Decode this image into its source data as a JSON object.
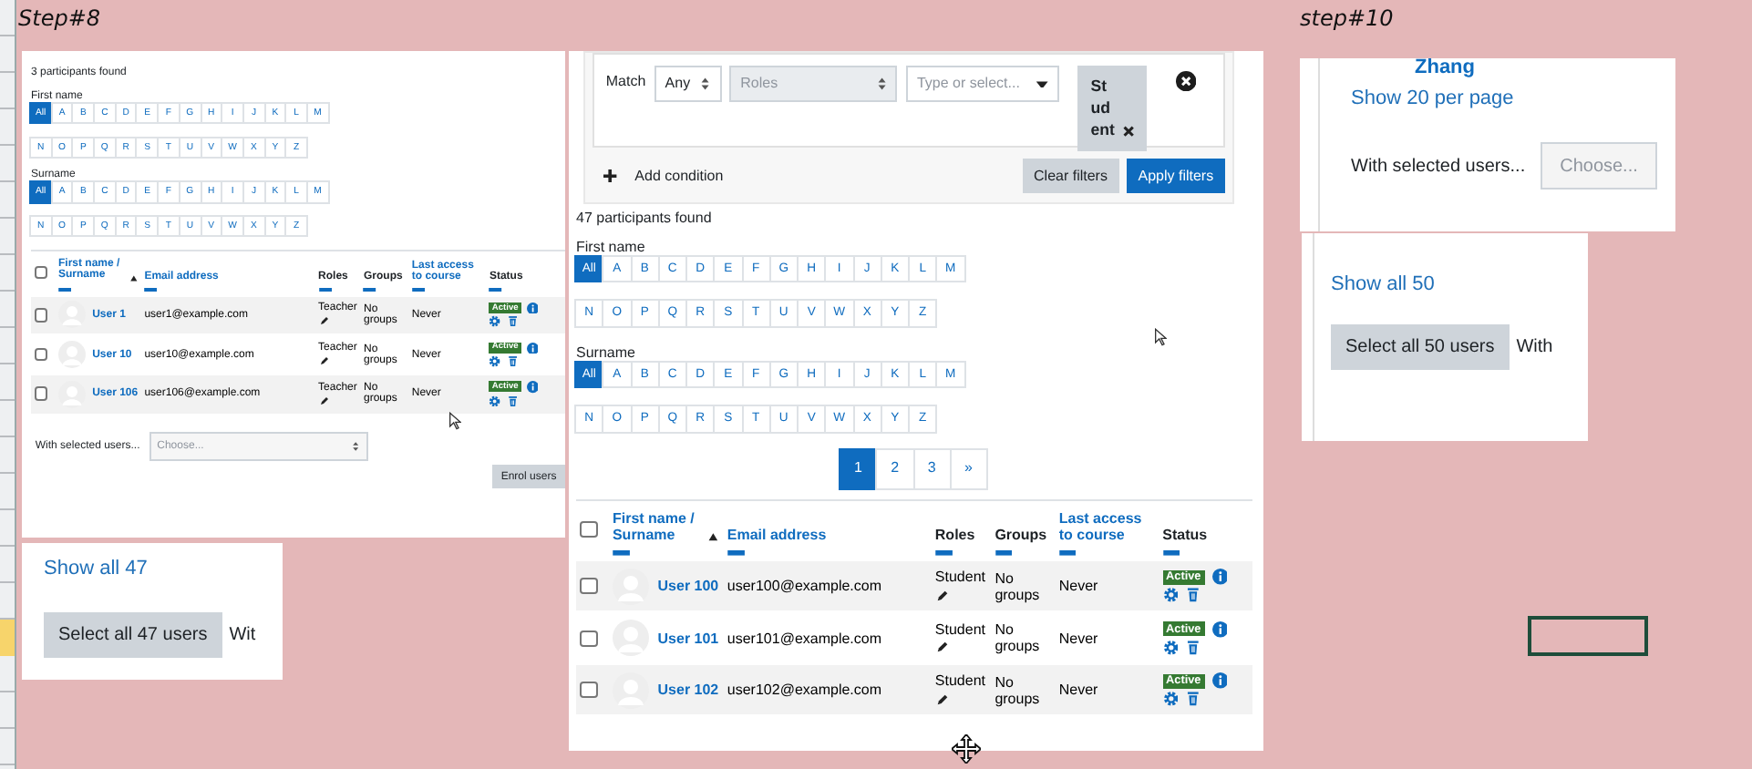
{
  "step_labels": [
    {
      "text": "Step#8"
    },
    {
      "text": "step#10"
    }
  ],
  "step8_panel": {
    "participants_found": "3 participants found",
    "initials": [
      {
        "label": "First name",
        "rows": [
          [
            {
              "label": "All",
              "selected": true
            },
            {
              "label": "A",
              "selected": false
            },
            {
              "label": "B",
              "selected": false
            },
            {
              "label": "C",
              "selected": false
            },
            {
              "label": "D",
              "selected": false
            },
            {
              "label": "E",
              "selected": false
            },
            {
              "label": "F",
              "selected": false
            },
            {
              "label": "G",
              "selected": false
            },
            {
              "label": "H",
              "selected": false
            },
            {
              "label": "I",
              "selected": false
            },
            {
              "label": "J",
              "selected": false
            },
            {
              "label": "K",
              "selected": false
            },
            {
              "label": "L",
              "selected": false
            },
            {
              "label": "M",
              "selected": false
            }
          ],
          [
            {
              "label": "N",
              "selected": false
            },
            {
              "label": "O",
              "selected": false
            },
            {
              "label": "P",
              "selected": false
            },
            {
              "label": "Q",
              "selected": false
            },
            {
              "label": "R",
              "selected": false
            },
            {
              "label": "S",
              "selected": false
            },
            {
              "label": "T",
              "selected": false
            },
            {
              "label": "U",
              "selected": false
            },
            {
              "label": "V",
              "selected": false
            },
            {
              "label": "W",
              "selected": false
            },
            {
              "label": "X",
              "selected": false
            },
            {
              "label": "Y",
              "selected": false
            },
            {
              "label": "Z",
              "selected": false
            }
          ]
        ]
      },
      {
        "label": "Surname",
        "rows": [
          [
            {
              "label": "All",
              "selected": true
            },
            {
              "label": "A",
              "selected": false
            },
            {
              "label": "B",
              "selected": false
            },
            {
              "label": "C",
              "selected": false
            },
            {
              "label": "D",
              "selected": false
            },
            {
              "label": "E",
              "selected": false
            },
            {
              "label": "F",
              "selected": false
            },
            {
              "label": "G",
              "selected": false
            },
            {
              "label": "H",
              "selected": false
            },
            {
              "label": "I",
              "selected": false
            },
            {
              "label": "J",
              "selected": false
            },
            {
              "label": "K",
              "selected": false
            },
            {
              "label": "L",
              "selected": false
            },
            {
              "label": "M",
              "selected": false
            }
          ],
          [
            {
              "label": "N",
              "selected": false
            },
            {
              "label": "O",
              "selected": false
            },
            {
              "label": "P",
              "selected": false
            },
            {
              "label": "Q",
              "selected": false
            },
            {
              "label": "R",
              "selected": false
            },
            {
              "label": "S",
              "selected": false
            },
            {
              "label": "T",
              "selected": false
            },
            {
              "label": "U",
              "selected": false
            },
            {
              "label": "V",
              "selected": false
            },
            {
              "label": "W",
              "selected": false
            },
            {
              "label": "X",
              "selected": false
            },
            {
              "label": "Y",
              "selected": false
            },
            {
              "label": "Z",
              "selected": false
            }
          ]
        ]
      }
    ],
    "table": {
      "select_all_checked": false,
      "columns": [
        {
          "label": "First name / Surname",
          "sortable": true,
          "sorted": true
        },
        {
          "label": "Email address",
          "sortable": true,
          "sorted": false
        },
        {
          "label": "Roles",
          "sortable": false,
          "sorted": false
        },
        {
          "label": "Groups",
          "sortable": false,
          "sorted": false
        },
        {
          "label": "Last access to course",
          "sortable": true,
          "sorted": false
        },
        {
          "label": "Status",
          "sortable": false,
          "sorted": false
        }
      ],
      "rows": [
        {
          "checked": false,
          "name": "User 1",
          "email": "user1@example.com",
          "roles": "Teacher",
          "groups": "No groups",
          "last_access": "Never",
          "status": "Active"
        },
        {
          "checked": false,
          "name": "User 10",
          "email": "user10@example.com",
          "roles": "Teacher",
          "groups": "No groups",
          "last_access": "Never",
          "status": "Active"
        },
        {
          "checked": false,
          "name": "User 106",
          "email": "user106@example.com",
          "roles": "Teacher",
          "groups": "No groups",
          "last_access": "Never",
          "status": "Active"
        }
      ]
    },
    "bulk_label": "With selected users...",
    "bulk_placeholder": "Choose...",
    "enrol_button": "Enrol users"
  },
  "step8_footer": {
    "show_all": "Show all 47",
    "select_all_button": "Select all 47 users",
    "trailing_text": "Wit"
  },
  "filter_panel": {
    "match_label": "Match",
    "match_value": "Any",
    "type_value": "Roles",
    "type_disabled": true,
    "value_placeholder": "Type or select...",
    "chips": [
      {
        "label": "Student"
      }
    ],
    "add_condition": "Add condition",
    "clear_button": "Clear filters",
    "apply_button": "Apply filters"
  },
  "participants_panel": {
    "participants_found": "47 participants found",
    "initials": [
      {
        "label": "First name",
        "rows": [
          [
            {
              "label": "All",
              "selected": true
            },
            {
              "label": "A",
              "selected": false
            },
            {
              "label": "B",
              "selected": false
            },
            {
              "label": "C",
              "selected": false
            },
            {
              "label": "D",
              "selected": false
            },
            {
              "label": "E",
              "selected": false
            },
            {
              "label": "F",
              "selected": false
            },
            {
              "label": "G",
              "selected": false
            },
            {
              "label": "H",
              "selected": false
            },
            {
              "label": "I",
              "selected": false
            },
            {
              "label": "J",
              "selected": false
            },
            {
              "label": "K",
              "selected": false
            },
            {
              "label": "L",
              "selected": false
            },
            {
              "label": "M",
              "selected": false
            }
          ],
          [
            {
              "label": "N",
              "selected": false
            },
            {
              "label": "O",
              "selected": false
            },
            {
              "label": "P",
              "selected": false
            },
            {
              "label": "Q",
              "selected": false
            },
            {
              "label": "R",
              "selected": false
            },
            {
              "label": "S",
              "selected": false
            },
            {
              "label": "T",
              "selected": false
            },
            {
              "label": "U",
              "selected": false
            },
            {
              "label": "V",
              "selected": false
            },
            {
              "label": "W",
              "selected": false
            },
            {
              "label": "X",
              "selected": false
            },
            {
              "label": "Y",
              "selected": false
            },
            {
              "label": "Z",
              "selected": false
            }
          ]
        ]
      },
      {
        "label": "Surname",
        "rows": [
          [
            {
              "label": "All",
              "selected": true
            },
            {
              "label": "A",
              "selected": false
            },
            {
              "label": "B",
              "selected": false
            },
            {
              "label": "C",
              "selected": false
            },
            {
              "label": "D",
              "selected": false
            },
            {
              "label": "E",
              "selected": false
            },
            {
              "label": "F",
              "selected": false
            },
            {
              "label": "G",
              "selected": false
            },
            {
              "label": "H",
              "selected": false
            },
            {
              "label": "I",
              "selected": false
            },
            {
              "label": "J",
              "selected": false
            },
            {
              "label": "K",
              "selected": false
            },
            {
              "label": "L",
              "selected": false
            },
            {
              "label": "M",
              "selected": false
            }
          ],
          [
            {
              "label": "N",
              "selected": false
            },
            {
              "label": "O",
              "selected": false
            },
            {
              "label": "P",
              "selected": false
            },
            {
              "label": "Q",
              "selected": false
            },
            {
              "label": "R",
              "selected": false
            },
            {
              "label": "S",
              "selected": false
            },
            {
              "label": "T",
              "selected": false
            },
            {
              "label": "U",
              "selected": false
            },
            {
              "label": "V",
              "selected": false
            },
            {
              "label": "W",
              "selected": false
            },
            {
              "label": "X",
              "selected": false
            },
            {
              "label": "Y",
              "selected": false
            },
            {
              "label": "Z",
              "selected": false
            }
          ]
        ]
      }
    ],
    "pages": [
      {
        "label": "1",
        "selected": true
      },
      {
        "label": "2",
        "selected": false
      },
      {
        "label": "3",
        "selected": false
      },
      {
        "label": "»",
        "selected": false
      }
    ],
    "table": {
      "select_all_checked": false,
      "columns": [
        {
          "label": "First name / Surname",
          "sortable": true,
          "sorted": true
        },
        {
          "label": "Email address",
          "sortable": true,
          "sorted": false
        },
        {
          "label": "Roles",
          "sortable": false,
          "sorted": false
        },
        {
          "label": "Groups",
          "sortable": false,
          "sorted": false
        },
        {
          "label": "Last access to course",
          "sortable": true,
          "sorted": false
        },
        {
          "label": "Status",
          "sortable": false,
          "sorted": false
        }
      ],
      "rows": [
        {
          "checked": false,
          "name": "User 100",
          "email": "user100@example.com",
          "roles": "Student",
          "groups": "No groups",
          "last_access": "Never",
          "status": "Active"
        },
        {
          "checked": false,
          "name": "User 101",
          "email": "user101@example.com",
          "roles": "Student",
          "groups": "No groups",
          "last_access": "Never",
          "status": "Active"
        },
        {
          "checked": false,
          "name": "User 102",
          "email": "user102@example.com",
          "roles": "Student",
          "groups": "No groups",
          "last_access": "Never",
          "status": "Active"
        }
      ]
    }
  },
  "step10_top": {
    "name_partial": "Zhang",
    "show_per_page": "Show 20 per page",
    "bulk_label": "With selected users...",
    "bulk_placeholder": "Choose..."
  },
  "step10_bottom": {
    "show_all": "Show all 50",
    "select_all_button": "Select all 50 users",
    "trailing_text": "With"
  }
}
